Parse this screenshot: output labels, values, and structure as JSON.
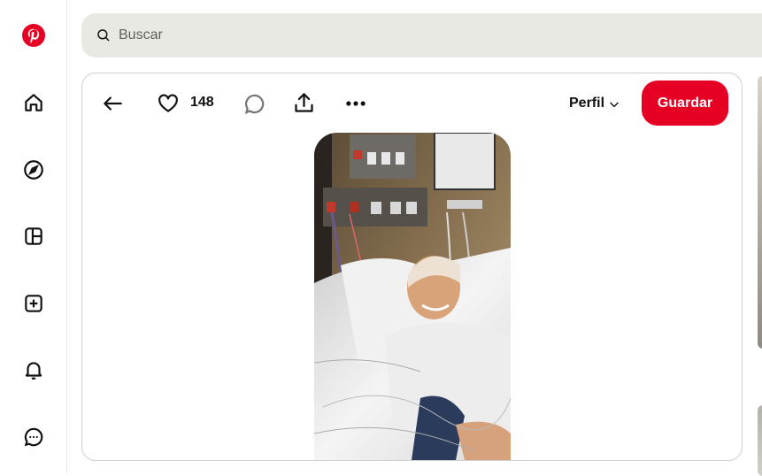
{
  "app": {
    "brand_color": "#e60023"
  },
  "sidebar": {
    "items": [
      {
        "name": "logo",
        "icon": "pinterest-logo"
      },
      {
        "name": "home",
        "icon": "home-icon"
      },
      {
        "name": "explore",
        "icon": "compass-icon"
      },
      {
        "name": "boards",
        "icon": "boards-icon"
      },
      {
        "name": "create",
        "icon": "plus-square-icon"
      },
      {
        "name": "notifications",
        "icon": "bell-icon"
      },
      {
        "name": "messages",
        "icon": "chat-icon"
      }
    ]
  },
  "search": {
    "placeholder": "Buscar",
    "value": ""
  },
  "pin": {
    "likes": "148",
    "profile_label": "Perfil",
    "save_label": "Guardar",
    "image_alt": "Pin image"
  }
}
